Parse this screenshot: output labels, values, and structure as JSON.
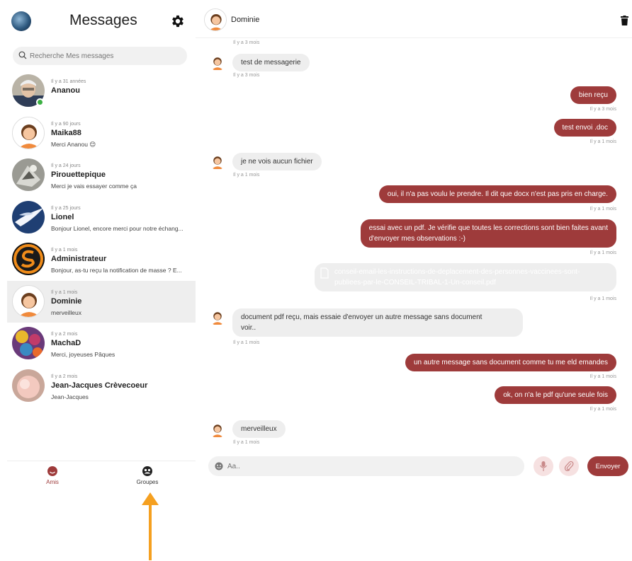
{
  "sidebar": {
    "title": "Messages",
    "search_placeholder": "Recherche Mes messages",
    "contacts": [
      {
        "time": "Il y a 31 années",
        "name": "Ananou",
        "last": ""
      },
      {
        "time": "Il y a 90 jours",
        "name": "Maika88",
        "last": "Merci Ananou 😊"
      },
      {
        "time": "Il y a 24 jours",
        "name": "Pirouettepique",
        "last": "Merci je vais essayer comme ça"
      },
      {
        "time": "Il y a 25 jours",
        "name": "Lionel",
        "last": "Bonjour Lionel, encore merci pour notre échang..."
      },
      {
        "time": "Il y a 1 mois",
        "name": "Administrateur",
        "last": "Bonjour, as-tu reçu la notification de masse ? E..."
      },
      {
        "time": "Il y a 1 mois",
        "name": "Dominie",
        "last": "merveilleux"
      },
      {
        "time": "Il y a 2 mois",
        "name": "MachaD",
        "last": "Merci, joyeuses Pâques"
      },
      {
        "time": "Il y a 2 mois",
        "name": "Jean-Jacques Crèvecoeur",
        "last": "Jean-Jacques"
      }
    ],
    "nav": {
      "friends": "Amis",
      "groups": "Groupes"
    }
  },
  "chat": {
    "contact_name": "Dominie",
    "top_time": "Il y a 3 mois",
    "messages": [
      {
        "dir": "in",
        "text": "test de messagerie",
        "time": "Il y a 3 mois"
      },
      {
        "dir": "out",
        "text": "bien reçu",
        "time": "Il y a 3 mois"
      },
      {
        "dir": "out",
        "text": "test envoi .doc",
        "time": "Il y a 1 mois"
      },
      {
        "dir": "in",
        "text": "je ne vois aucun fichier",
        "time": "Il y a 1 mois"
      },
      {
        "dir": "out",
        "text": "oui, il n'a pas voulu le prendre. Il dit que docx n'est pas pris en charge.",
        "time": "Il y a 1 mois"
      },
      {
        "dir": "out",
        "text1": "essai avec un pdf. Je vérifie que toutes les corrections sont bien faites avant",
        "text2": "d'envoyer mes observations :-)",
        "time": "Il y a 1 mois"
      },
      {
        "dir": "out",
        "text1": "conseil-email-les-instructions-de-deplacement-des-personnes-vaccinees-sont-",
        "text2": "publiees-par-le-CONSEIL-TRIBAL-1-Un-conseil.pdf",
        "time": "Il y a 1 mois"
      },
      {
        "dir": "in",
        "text1": "document pdf reçu, mais essaie d'envoyer un autre message sans document",
        "text2": "voir..",
        "time": "Il y a 1 mois"
      },
      {
        "dir": "out",
        "text": "un autre message sans document comme tu me eld emandes",
        "time": "Il y a 1 mois"
      },
      {
        "dir": "out",
        "text": "ok, on n'a le pdf qu'une seule fois",
        "time": "Il y a 1 mois"
      },
      {
        "dir": "in",
        "text": "merveilleux",
        "time": "Il y a 1 mois"
      }
    ],
    "input_placeholder": "Aa..",
    "send_label": "Envoyer"
  },
  "colors": {
    "accent": "#9e3b3b",
    "bubble_in": "#eeeeee",
    "online": "#3cb043",
    "arrow": "#f5a020"
  }
}
